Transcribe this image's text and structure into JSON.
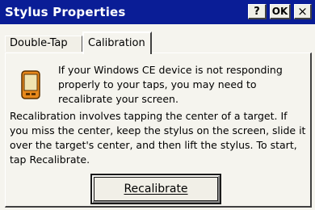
{
  "window": {
    "title": "Stylus Properties",
    "help_label": "?",
    "ok_label": "OK",
    "close_label": "×"
  },
  "tabs": [
    {
      "label": "Double-Tap",
      "active": false
    },
    {
      "label": "Calibration",
      "active": true
    }
  ],
  "calibration": {
    "icon": "pda-device-icon",
    "intro_text": "If your Windows CE device is not responding properly to your taps, you may need to recalibrate your screen.",
    "instructions_text": "Recalibration involves tapping the center of a target. If you miss the center, keep the stylus on the screen, slide it over the target's center, and then lift the stylus. To start, tap Recalibrate.",
    "recalibrate_label": "Recalibrate"
  },
  "colors": {
    "titlebar": "#0a1d96",
    "dialog_bg": "#f5f4ee",
    "device_orange": "#e8891c"
  }
}
